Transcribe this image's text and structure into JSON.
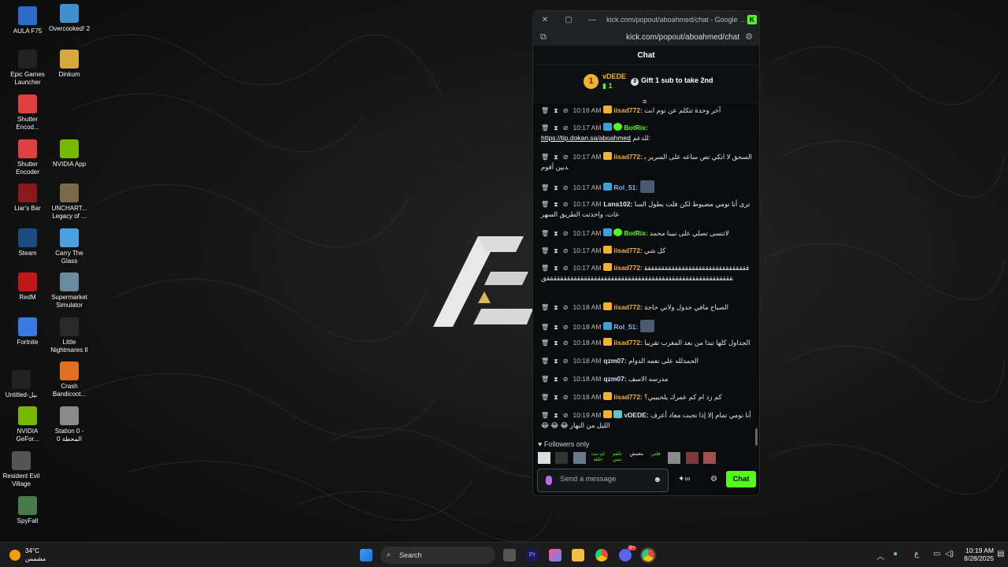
{
  "desktop": {
    "icons": [
      {
        "label": "AULA F75",
        "color": "#2a6cc8"
      },
      {
        "label": "Overcooked! 2",
        "color": "#3f8fcf"
      },
      {
        "label": "Epic Games Launcher",
        "color": "#222"
      },
      {
        "label": "Dinkum",
        "color": "#d8a840"
      },
      {
        "label": "Shutter Encod...",
        "color": "#e04040"
      },
      {
        "label": "Shutter Encoder",
        "color": "#e04040"
      },
      {
        "label": "NVIDIA App",
        "color": "#76b900"
      },
      {
        "label": "Liar's Bar",
        "color": "#8a1a1a"
      },
      {
        "label": "UNCHART... Legacy of ...",
        "color": "#7a6a4a"
      },
      {
        "label": "Steam",
        "color": "#1b4b80"
      },
      {
        "label": "Carry The Glass",
        "color": "#4aa0e0"
      },
      {
        "label": "RedM",
        "color": "#c01818"
      },
      {
        "label": "Supermarket Simulator",
        "color": "#6a8aa0"
      },
      {
        "label": "Fortnite",
        "color": "#3a7ae0"
      },
      {
        "label": "Little Nightmares II",
        "color": "#2a2a2a"
      },
      {
        "label": "Untitled-بيل",
        "color": "#222"
      },
      {
        "label": "Crash Bandicoot...",
        "color": "#e07020"
      },
      {
        "label": "NVIDIA GeFor...",
        "color": "#76b900"
      },
      {
        "label": "Station 0 - المحطة 0",
        "color": "#8a8a8a"
      },
      {
        "label": "Resident Evil Village",
        "color": "#555"
      },
      {
        "label": "SpyFall",
        "color": "#4a7a4a"
      }
    ]
  },
  "chat_window": {
    "title": "kick.com/popout/aboahmed/chat - Google Chro...",
    "url": "kick.com/popout/aboahmed/chat",
    "header": "Chat",
    "pinned": {
      "rank": "1",
      "user": "vDEDE",
      "count": "1",
      "gift_text": "Gift 1 sub to take 2nd",
      "gift_icon": "3"
    },
    "messages": [
      {
        "time": "10:16 AM",
        "user": "iisad772:",
        "text": "آخر وحدة تتكلم عن نوم انت",
        "user_color": "#f2b230",
        "badges": [
          "crown"
        ]
      },
      {
        "time": "10:17 AM",
        "user": "BotRix:",
        "text": "",
        "link": "https://tip.dokan.sa/aboahmed",
        "link_suffix": "للدعم:",
        "user_color": "#53fc18",
        "badges": [
          "mod",
          "verified"
        ]
      },
      {
        "time": "10:17 AM",
        "user": "iisad772:",
        "text": "السحق لا انكي تص ساعه على السرير بدبين أقوم",
        "user_color": "#f2b230",
        "badges": [
          "crown"
        ]
      },
      {
        "time": "10:17 AM",
        "user": "Rol_51:",
        "text": "",
        "user_color": "#8fb3ff",
        "badges": [
          "mod"
        ]
      },
      {
        "time": "10:17 AM",
        "user": "Lana102:",
        "text": "ترى أنا نومي مضبوط لكن فلت بطول الساعات، واخذتت الطريق السهر",
        "user_color": "#e8e8e8",
        "badges": []
      },
      {
        "time": "10:17 AM",
        "user": "BotRix:",
        "text": "لاتنسى تصلي على نبينا محمد",
        "user_color": "#53fc18",
        "badges": [
          "mod",
          "verified"
        ]
      },
      {
        "time": "10:17 AM",
        "user": "iisad772:",
        "text": "كل شي",
        "user_color": "#f2b230",
        "badges": [
          "crown"
        ]
      },
      {
        "time": "10:17 AM",
        "user": "iisad772:",
        "text": "‏ققققققققققققققققققققققققققققققققققققققققققققققققققققققققققققققققققققققققققققققققققققققق",
        "user_color": "#f2b230",
        "badges": [
          "crown"
        ]
      },
      {
        "time": "10:18 AM",
        "user": "iisad772:",
        "text": "الصباح مافي جدول ولاني حاجة",
        "user_color": "#f2b230",
        "badges": [
          "crown"
        ]
      },
      {
        "time": "10:18 AM",
        "user": "Rol_51:",
        "text": "",
        "user_color": "#8fb3ff",
        "badges": [
          "mod"
        ]
      },
      {
        "time": "10:18 AM",
        "user": "iisad772:",
        "text": "الجداول كلها تبدا من بعد المغرب تقريبا",
        "user_color": "#f2b230",
        "badges": [
          "crown"
        ]
      },
      {
        "time": "10:18 AM",
        "user": "qzm07:",
        "text": "الحمدلله على نعمه الدوام",
        "user_color": "#cfe4ff",
        "badges": []
      },
      {
        "time": "10:18 AM",
        "user": "qzm07:",
        "text": "مدرسه الاسف",
        "user_color": "#cfe4ff",
        "badges": []
      },
      {
        "time": "10:18 AM",
        "user": "iisad772:",
        "text": "كم زد ام كم عمرك يلحبيبي؟",
        "user_color": "#f2b230",
        "badges": [
          "crown"
        ]
      },
      {
        "time": "10:19 AM",
        "user": "vDEDE:",
        "text": "أنا نومي تمام إلا إذا تحبت معاد أعرف الليل من النهار 😂 😂 😂",
        "user_color": "#cfe4ff",
        "badges": [
          "crown",
          "sub"
        ]
      }
    ],
    "followers_only": "Followers only",
    "emote_text_1": "لم نبث حلقة",
    "emote_text_2": "تكفم تنس",
    "emote_text_3": "معتبش",
    "emote_text_4": "فلتي",
    "input_placeholder": "Send a message",
    "chat_button": "Chat",
    "accent": "#53fc18"
  },
  "taskbar": {
    "temperature": "34°C",
    "weather_desc": "مشمس",
    "search_label": "Search",
    "time": "10:19 AM",
    "date": "8/28/2025",
    "lang": "ع",
    "discord_badge": "9+"
  }
}
